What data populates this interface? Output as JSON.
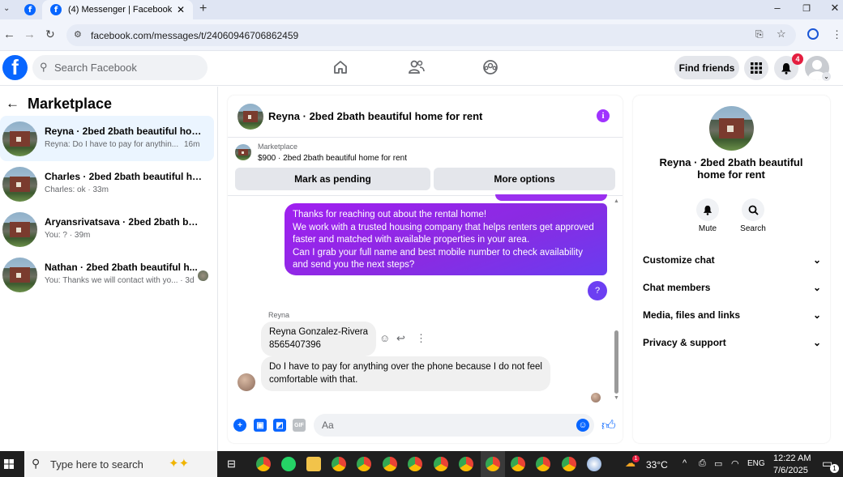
{
  "browser": {
    "tab_title": "(4) Messenger | Facebook",
    "url": "facebook.com/messages/t/24060946706862459"
  },
  "header": {
    "search_placeholder": "Search Facebook",
    "find_friends": "Find friends",
    "notification_count": "4"
  },
  "sidebar": {
    "title": "Marketplace",
    "conversations": [
      {
        "name": "Reyna · 2bed 2bath beautiful hom...",
        "preview": "Reyna: Do I have to pay for anythin...",
        "time": "16m"
      },
      {
        "name": "Charles · 2bed 2bath beautiful ho...",
        "preview": "Charles: ok",
        "time": "33m"
      },
      {
        "name": "Aryansrivatsava · 2bed 2bath beau...",
        "preview": "You: ?",
        "time": "39m"
      },
      {
        "name": "Nathan · 2bed 2bath beautiful h...",
        "preview": "You: Thanks we will contact with yo...",
        "time": "3d"
      }
    ]
  },
  "chat": {
    "title": "Reyna · 2bed 2bath beautiful home for rent",
    "marketplace_label": "Marketplace",
    "listing": "$900 · 2bed 2bath beautiful home for rent",
    "mark_pending": "Mark as pending",
    "more_options": "More options",
    "outgoing": [
      "Thanks for reaching out about the rental home!",
      "We work with a trusted housing company that helps renters get approved faster and matched with available properties in your area.",
      "Can I grab your full name and best mobile number to check availability and send you the next steps?"
    ],
    "outgoing_q": "?",
    "sender": "Reyna",
    "incoming_1": [
      "Reyna Gonzalez-Rivera",
      "8565407396"
    ],
    "incoming_2": [
      "Do I have to pay for anything over the phone because I do not feel",
      "comfortable with that."
    ],
    "composer_placeholder": "Aa"
  },
  "details": {
    "title": "Reyna · 2bed 2bath beautiful home for rent",
    "mute": "Mute",
    "search": "Search",
    "sections": [
      "Customize chat",
      "Chat members",
      "Media, files and links",
      "Privacy & support"
    ]
  },
  "taskbar": {
    "search_placeholder": "Type here to search",
    "temperature": "33°C",
    "language": "ENG",
    "time": "12:22 AM",
    "date": "7/6/2025",
    "notif_count": "1"
  },
  "colors": {
    "brand": "#0866ff",
    "message_gradient_start": "#a020f0",
    "message_gradient_end": "#6a3cf0",
    "info": "#a033ff"
  }
}
